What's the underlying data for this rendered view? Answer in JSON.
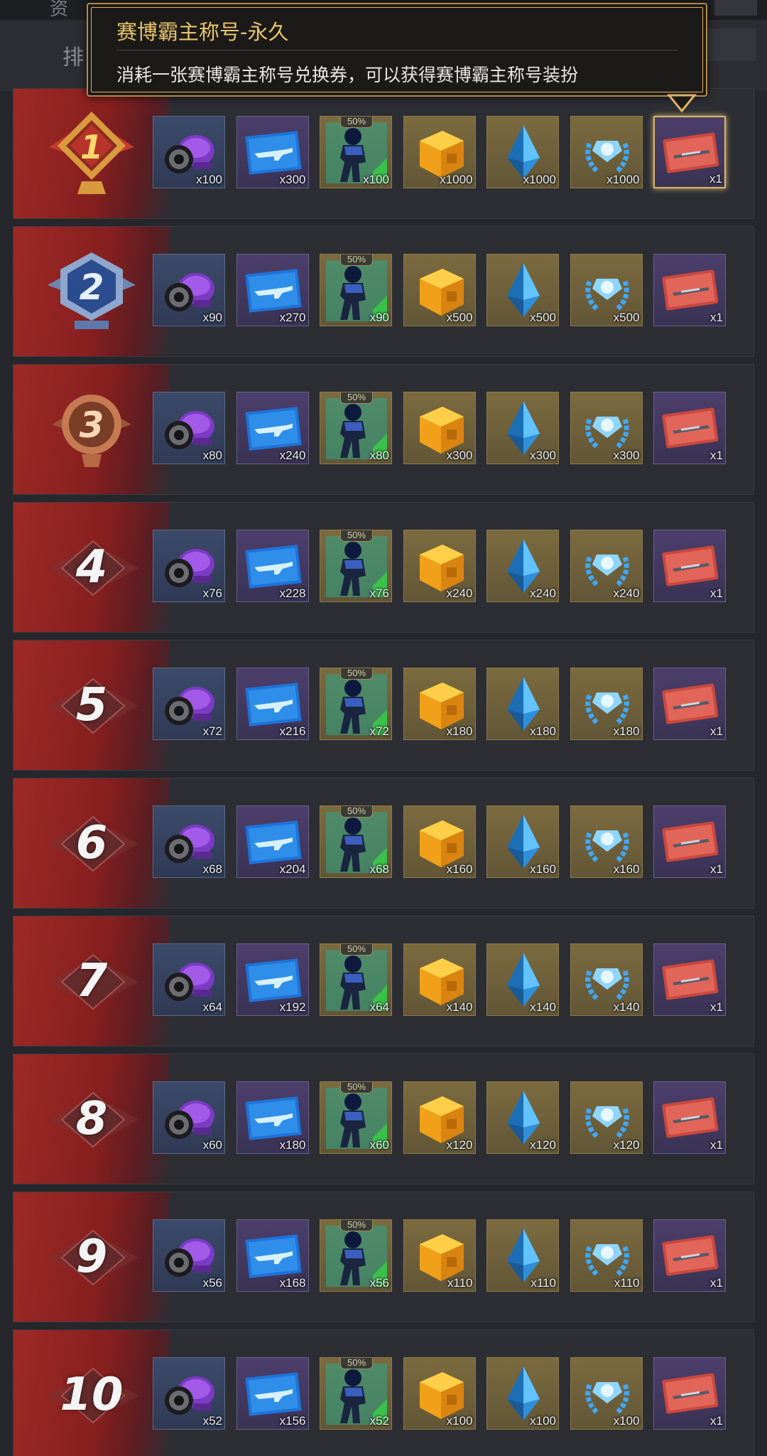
{
  "header": {
    "top_caption": "资",
    "rank_tab_caption": "排"
  },
  "tooltip": {
    "title": "赛博霸主称号-永久",
    "description": "消耗一张赛博霸主称号兑换券，可以获得赛博霸主称号装扮"
  },
  "item_types": [
    {
      "icon": "purple-goggles-icon",
      "frame": "blue"
    },
    {
      "icon": "blue-weapon-blueprint-icon",
      "frame": "purple"
    },
    {
      "icon": "armored-soldier-icon",
      "frame": "gold",
      "badge": "50%"
    },
    {
      "icon": "orange-crate-icon",
      "frame": "gold"
    },
    {
      "icon": "blue-crystal-icon",
      "frame": "gold"
    },
    {
      "icon": "laurel-emblem-icon",
      "frame": "gold"
    },
    {
      "icon": "title-ticket-icon",
      "frame": "purple"
    }
  ],
  "rows": [
    {
      "rank": "1",
      "medal": "gold",
      "quantities": [
        "x100",
        "x300",
        "x100",
        "x1000",
        "x1000",
        "x1000",
        "x1"
      ]
    },
    {
      "rank": "2",
      "medal": "silver",
      "quantities": [
        "x90",
        "x270",
        "x90",
        "x500",
        "x500",
        "x500",
        "x1"
      ]
    },
    {
      "rank": "3",
      "medal": "bronze",
      "quantities": [
        "x80",
        "x240",
        "x80",
        "x300",
        "x300",
        "x300",
        "x1"
      ]
    },
    {
      "rank": "4",
      "quantities": [
        "x76",
        "x228",
        "x76",
        "x240",
        "x240",
        "x240",
        "x1"
      ]
    },
    {
      "rank": "5",
      "quantities": [
        "x72",
        "x216",
        "x72",
        "x180",
        "x180",
        "x180",
        "x1"
      ]
    },
    {
      "rank": "6",
      "quantities": [
        "x68",
        "x204",
        "x68",
        "x160",
        "x160",
        "x160",
        "x1"
      ]
    },
    {
      "rank": "7",
      "quantities": [
        "x64",
        "x192",
        "x64",
        "x140",
        "x140",
        "x140",
        "x1"
      ]
    },
    {
      "rank": "8",
      "quantities": [
        "x60",
        "x180",
        "x60",
        "x120",
        "x120",
        "x120",
        "x1"
      ]
    },
    {
      "rank": "9",
      "quantities": [
        "x56",
        "x168",
        "x56",
        "x110",
        "x110",
        "x110",
        "x1"
      ]
    },
    {
      "rank": "10",
      "quantities": [
        "x52",
        "x156",
        "x52",
        "x100",
        "x100",
        "x100",
        "x1"
      ]
    }
  ],
  "colors": {
    "accent_gold": "#e8c46b",
    "row_red": "#9e2a26",
    "background": "#26272c"
  }
}
